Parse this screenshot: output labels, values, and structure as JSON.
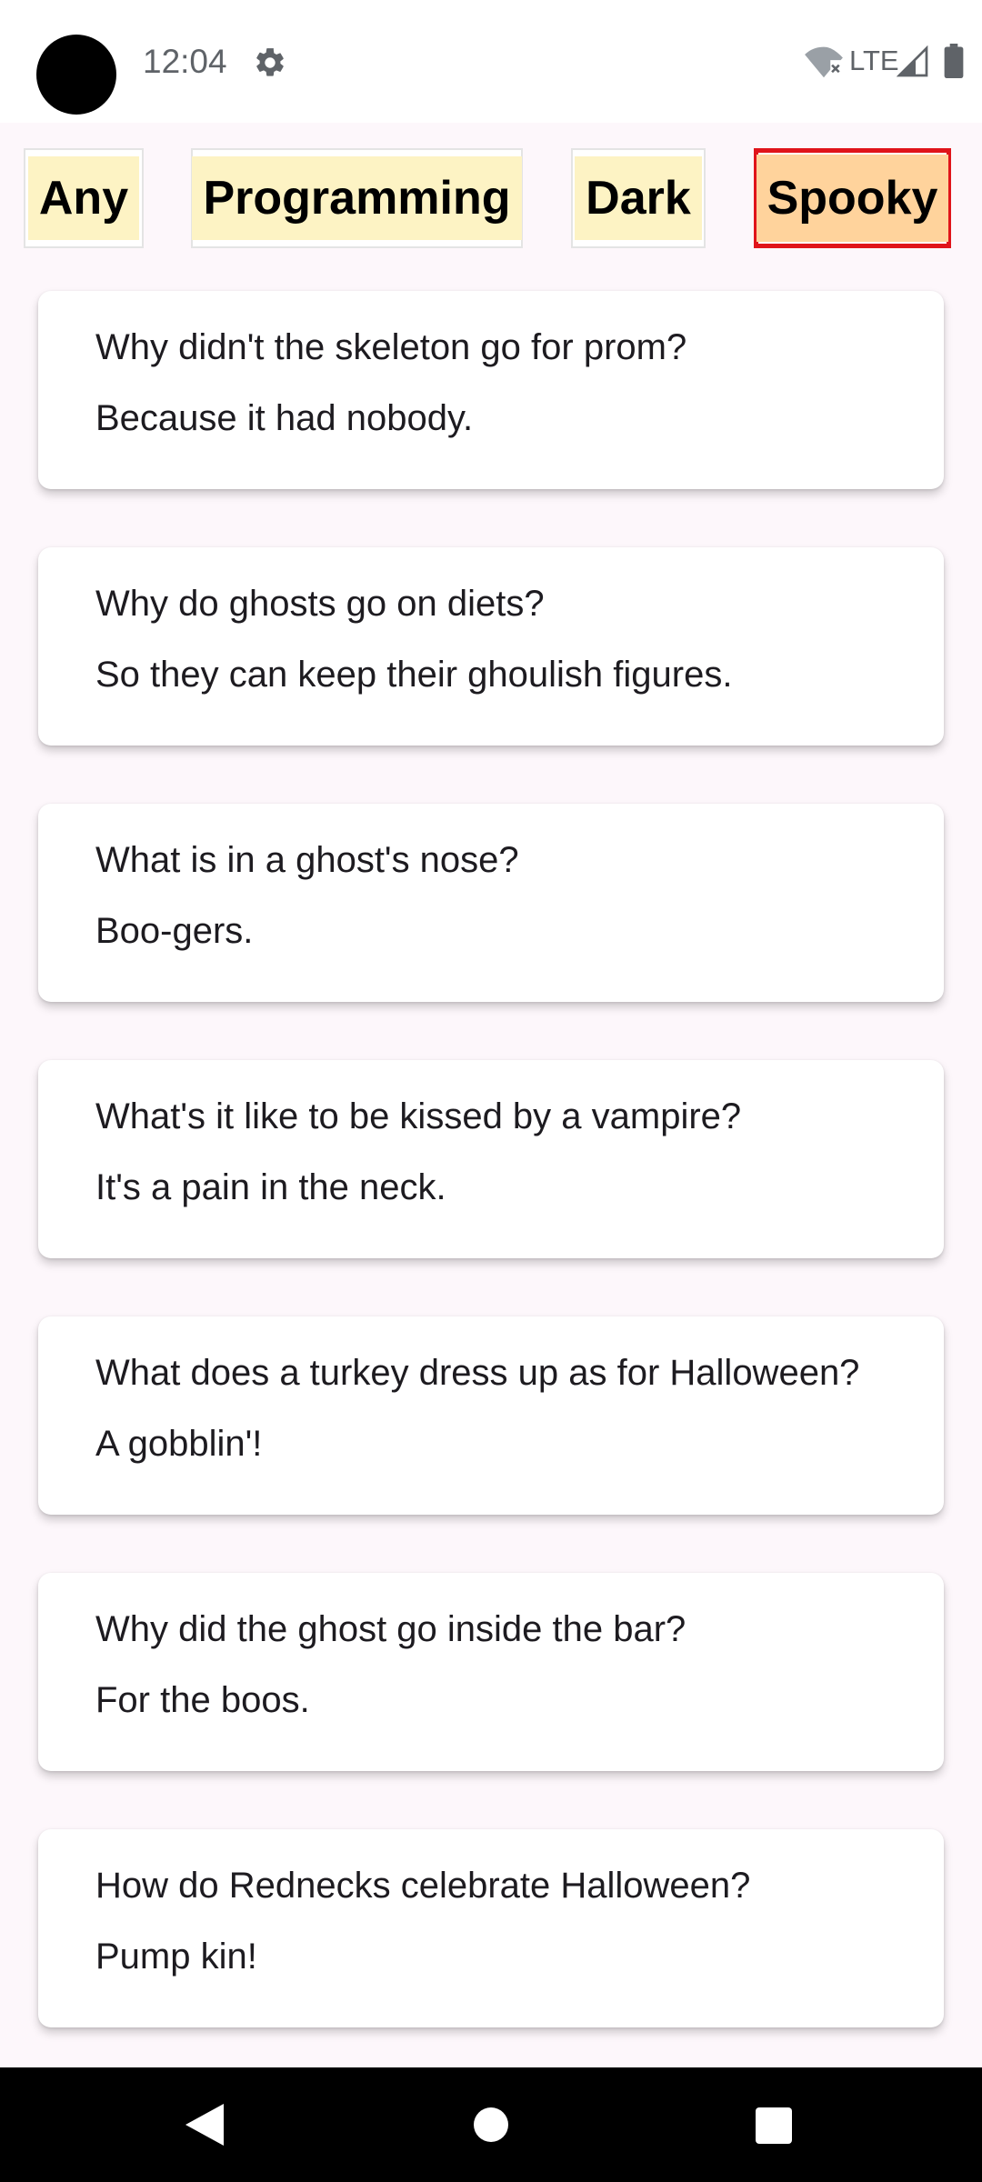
{
  "status_bar": {
    "time": "12:04",
    "network": "LTE",
    "icons": [
      "gear-icon",
      "wifi-off-icon",
      "signal-icon",
      "battery-icon"
    ]
  },
  "categories": [
    {
      "label": "Any",
      "selected": false
    },
    {
      "label": "Programming",
      "selected": false
    },
    {
      "label": "Dark",
      "selected": false
    },
    {
      "label": "Spooky",
      "selected": true
    }
  ],
  "jokes": [
    {
      "setup": "Why didn't the skeleton go for prom?",
      "delivery": "Because it had nobody."
    },
    {
      "setup": "Why do ghosts go on diets?",
      "delivery": "So they can keep their ghoulish figures."
    },
    {
      "setup": "What is in a ghost's nose?",
      "delivery": "Boo-gers."
    },
    {
      "setup": "What's it like to be kissed by a vampire?",
      "delivery": "It's a pain in the neck."
    },
    {
      "setup": "What does a turkey dress up as for Halloween?",
      "delivery": "A gobblin'!"
    },
    {
      "setup": "Why did the ghost go inside the bar?",
      "delivery": "For the boos."
    },
    {
      "setup": "How do Rednecks celebrate Halloween?",
      "delivery": "Pump kin!"
    }
  ],
  "colors": {
    "chip_fill": "#fdf3c4",
    "chip_selected_fill": "#ffd39c",
    "chip_selected_border": "#e0141a",
    "background": "#fdf7fb"
  },
  "nav_bar": {
    "icons": [
      "back-icon",
      "home-icon",
      "recents-icon"
    ]
  }
}
